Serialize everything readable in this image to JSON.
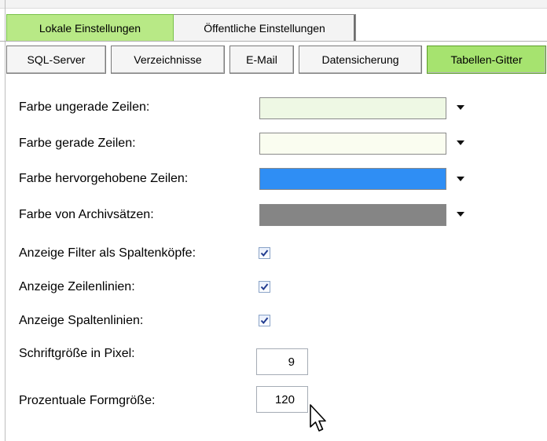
{
  "main_tabs": [
    {
      "label": "Lokale Einstellungen",
      "active": true
    },
    {
      "label": "Öffentliche Einstellungen",
      "active": false
    }
  ],
  "sub_tabs": [
    {
      "label": "SQL-Server",
      "active": false
    },
    {
      "label": "Verzeichnisse",
      "active": false
    },
    {
      "label": "E-Mail",
      "active": false
    },
    {
      "label": "Datensicherung",
      "active": false
    },
    {
      "label": "Tabellen-Gitter",
      "active": true
    }
  ],
  "colors": {
    "main_tab_active": "#b8e986",
    "sub_tab_active": "#a6e36f"
  },
  "settings": {
    "odd_rows": {
      "label": "Farbe ungerade Zeilen:",
      "color": "#eef8e4"
    },
    "even_rows": {
      "label": "Farbe gerade Zeilen:",
      "color": "#fafdf0"
    },
    "highlighted_rows": {
      "label": "Farbe hervorgehobene Zeilen:",
      "color": "#2f8ef4"
    },
    "archive_rows": {
      "label": "Farbe von Archivsätzen:",
      "color": "#858585"
    },
    "show_filter_headers": {
      "label": "Anzeige Filter als Spaltenköpfe:",
      "checked": true
    },
    "show_row_lines": {
      "label": "Anzeige Zeilenlinien:",
      "checked": true
    },
    "show_column_lines": {
      "label": "Anzeige Spaltenlinien:",
      "checked": true
    },
    "font_size": {
      "label": "Schriftgröße in Pixel:",
      "value": "9"
    },
    "form_size": {
      "label": "Prozentuale Formgröße:",
      "value": "120"
    }
  },
  "icons": {
    "dropdown": "chevron-down-icon",
    "check": "checkmark-icon",
    "cursor": "mouse-pointer-icon"
  }
}
